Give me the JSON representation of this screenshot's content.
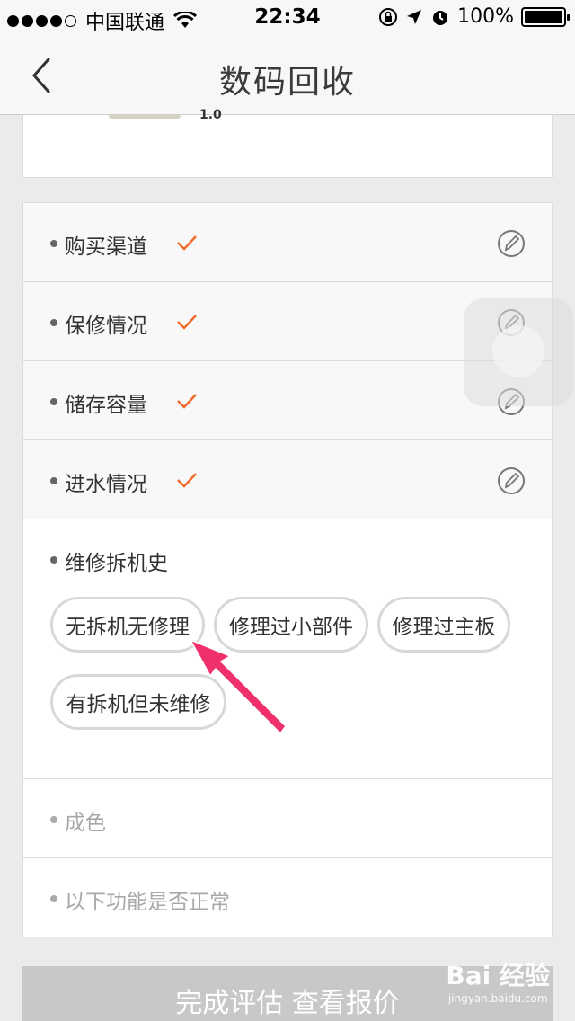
{
  "status_bar": {
    "carrier": "中国联通",
    "time": "22:34",
    "battery": "100%"
  },
  "nav": {
    "title": "数码回收",
    "back_icon": "chevron-left-icon"
  },
  "top_card": {
    "tail_text": "1.0"
  },
  "sections": [
    {
      "label": "购买渠道",
      "done": true
    },
    {
      "label": "保修情况",
      "done": true
    },
    {
      "label": "储存容量",
      "done": true
    },
    {
      "label": "进水情况",
      "done": true
    },
    {
      "label": "维修拆机史",
      "done": false
    },
    {
      "label": "成色",
      "done": false
    },
    {
      "label": "以下功能是否正常",
      "done": false
    }
  ],
  "repair_options": [
    "无拆机无修理",
    "修理过小部件",
    "修理过主板",
    "有拆机但未维修"
  ],
  "submit_label": "完成评估 查看报价",
  "watermark": {
    "brand": "Bai 经验",
    "url": "jingyan.baidu.com"
  },
  "colors": {
    "check": "#f06a2a",
    "arrow": "#f0306a",
    "button": "#c8c8c8"
  }
}
